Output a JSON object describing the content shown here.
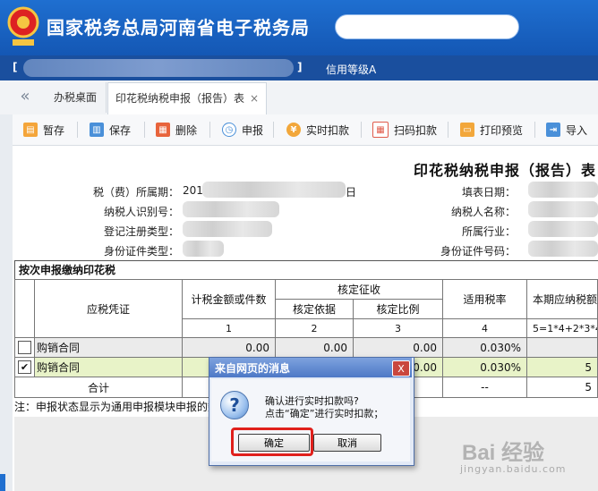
{
  "header": {
    "title": "国家税务总局河南省电子税务局",
    "credit_label": "信用等级A"
  },
  "tabs": {
    "back": "«",
    "home": "办税桌面",
    "active": "印花税纳税申报（报告）表",
    "close": "×"
  },
  "toolbar": {
    "items": [
      {
        "label": "暂存",
        "icon": "save-draft-icon",
        "color": "#f4a53a"
      },
      {
        "label": "保存",
        "icon": "document-icon",
        "color": "#4a90d9"
      },
      {
        "label": "删除",
        "icon": "trash-icon",
        "color": "#e8643c"
      },
      {
        "label": "申报",
        "icon": "clock-icon",
        "color": "#4a90d9"
      },
      {
        "label": "实时扣款",
        "icon": "coin-icon",
        "color": "#f2a73b"
      },
      {
        "label": "扫码扣款",
        "icon": "qr-icon",
        "color": "#e05b4b"
      },
      {
        "label": "打印预览",
        "icon": "printer-icon",
        "color": "#f2a73b"
      },
      {
        "label": "导入",
        "icon": "import-icon",
        "color": "#4a90d9"
      }
    ]
  },
  "form": {
    "title": "印花税纳税申报（报告）表",
    "period_label": "税（费）所属期：",
    "period_prefix": "201",
    "period_suffix": "日",
    "fill_date_label": "填表日期：",
    "taxpayer_id_label": "纳税人识别号：",
    "taxpayer_name_label": "纳税人名称：",
    "reg_type_label": "登记注册类型：",
    "industry_label": "所属行业：",
    "id_type_label": "身份证件类型：",
    "id_number_label": "身份证件号码："
  },
  "table": {
    "section_title": "按次申报缴纳印花税",
    "headers": {
      "voucher": "应税凭证",
      "amount": "计税金额或件数",
      "verified": "核定征收",
      "basis": "核定依据",
      "ratio": "核定比例",
      "rate": "适用税率",
      "payable": "本期应纳税额"
    },
    "index_row": {
      "c1": "1",
      "c2": "2",
      "c3": "3",
      "c4": "4",
      "c5": "5=1*4+2*3*4"
    },
    "rows": [
      {
        "name": "购销合同",
        "checked": false,
        "checkmark": "",
        "amount": "0.00",
        "basis": "0.00",
        "ratio": "0.00",
        "rate": "0.030%",
        "payable": ""
      },
      {
        "name": "购销合同",
        "checked": true,
        "checkmark": "✔",
        "amount": "",
        "basis": "",
        "ratio": "0.00",
        "rate": "0.030%",
        "payable": "5"
      }
    ],
    "total": {
      "label": "合计",
      "rate": "--",
      "payable": "5"
    }
  },
  "note": "注：申报状态显示为通用申报模块申报的数据，请到通用申报模块查看相关数据。",
  "dialog": {
    "title": "来自网页的消息",
    "icon": "question-icon",
    "line1": "确认进行实时扣款吗?",
    "line2": "点击“确定”进行实时扣款；",
    "ok": "确定",
    "cancel": "取消",
    "close": "X"
  },
  "watermark": {
    "text": "Bai 经验",
    "sub": "jingyan.baidu.com"
  }
}
